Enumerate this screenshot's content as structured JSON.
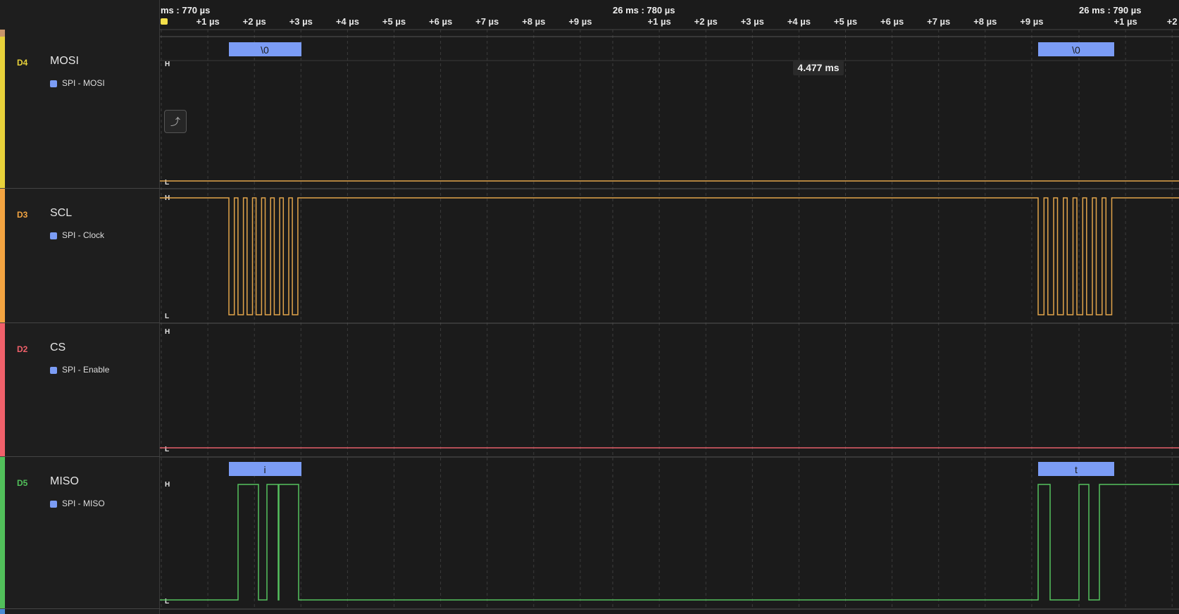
{
  "ruler": {
    "start_label": "ms : 770 µs",
    "mid_label": "26 ms : 780 µs",
    "end_label": "26 ms : 790 µs",
    "ticks_a": [
      "+1 µs",
      "+2 µs",
      "+3 µs",
      "+4 µs",
      "+5 µs",
      "+6 µs",
      "+7 µs",
      "+8 µs",
      "+9 µs"
    ],
    "ticks_b": [
      "+1 µs",
      "+2 µs",
      "+3 µs",
      "+4 µs",
      "+5 µs",
      "+6 µs",
      "+7 µs",
      "+8 µs",
      "+9 µs"
    ],
    "ticks_c": [
      "+1 µs",
      "+2"
    ]
  },
  "measurement": "4.477 ms",
  "levels": {
    "high": "H",
    "low": "L"
  },
  "trigger_icon": "rising-edge-trigger-icon",
  "channels": [
    {
      "id": "D4",
      "name": "MOSI",
      "analyzer": "SPI - MOSI",
      "color": "#e8d23a",
      "wave": "#e2a44b",
      "decodes": [
        "\\0",
        "\\0"
      ]
    },
    {
      "id": "D3",
      "name": "SCL",
      "analyzer": "SPI - Clock",
      "color": "#f3a441",
      "wave": "#e2a44b"
    },
    {
      "id": "D2",
      "name": "CS",
      "analyzer": "SPI - Enable",
      "color": "#f0606a",
      "wave": "#e5606a"
    },
    {
      "id": "D5",
      "name": "MISO",
      "analyzer": "SPI - MISO",
      "color": "#51c05a",
      "wave": "#55c25e",
      "decodes": [
        "i",
        "t"
      ]
    }
  ]
}
